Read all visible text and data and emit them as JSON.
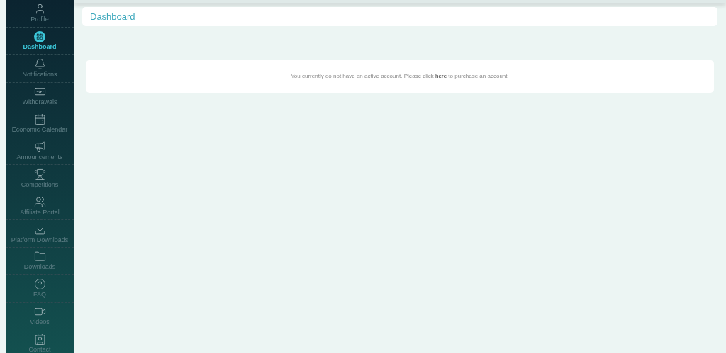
{
  "sidebar": {
    "items": [
      {
        "label": "Profile",
        "selected": false
      },
      {
        "label": "Dashboard",
        "selected": true
      },
      {
        "label": "Notifications",
        "selected": false
      },
      {
        "label": "Withdrawals",
        "selected": false
      },
      {
        "label": "Economic Calendar",
        "selected": false
      },
      {
        "label": "Announcements",
        "selected": false
      },
      {
        "label": "Competitions",
        "selected": false
      },
      {
        "label": "Affiliate Portal",
        "selected": false
      },
      {
        "label": "Platform Downloads",
        "selected": false
      },
      {
        "label": "Downloads",
        "selected": false
      },
      {
        "label": "FAQ",
        "selected": false
      },
      {
        "label": "Videos",
        "selected": false
      },
      {
        "label": "Contact",
        "selected": false
      }
    ]
  },
  "header": {
    "title": "Dashboard"
  },
  "notice": {
    "before": "You currently do not have an active account. Please click ",
    "link": "here",
    "after": " to purchase an account."
  }
}
